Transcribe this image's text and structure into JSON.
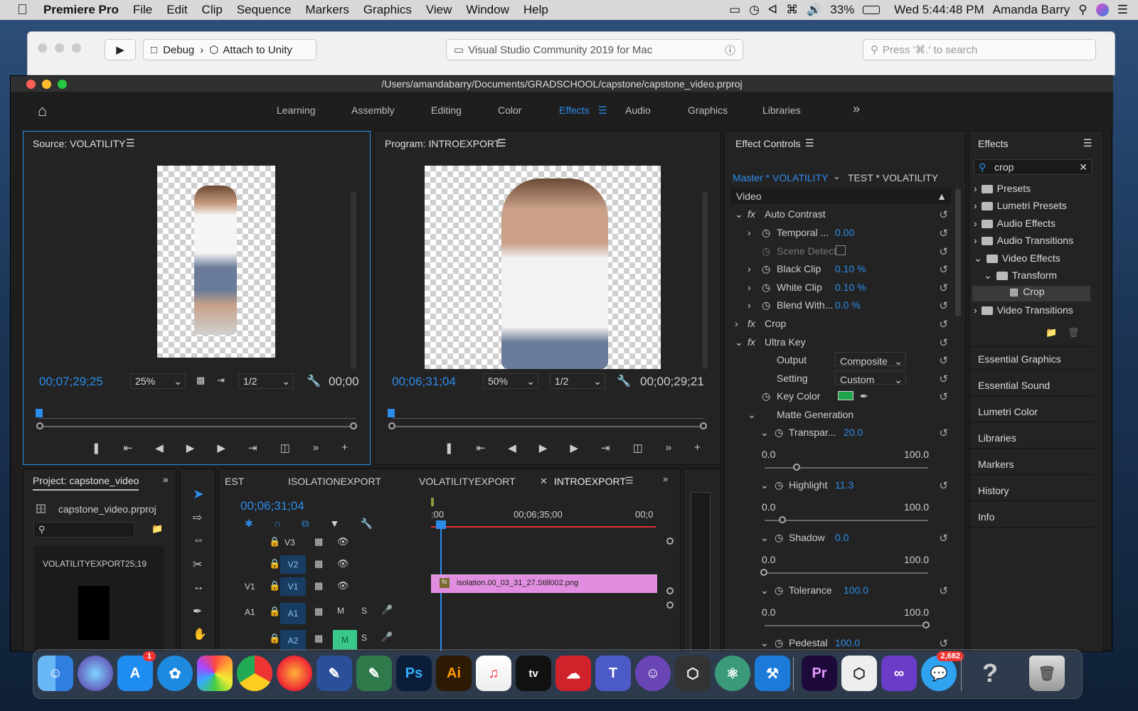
{
  "menubar": {
    "app": "Premiere Pro",
    "items": [
      "File",
      "Edit",
      "Clip",
      "Sequence",
      "Markers",
      "Graphics",
      "View",
      "Window",
      "Help"
    ],
    "battery": "33%",
    "clock": "Wed 5:44:48 PM",
    "user": "Amanda Barry"
  },
  "vs": {
    "config": "Debug",
    "target": "Attach to Unity",
    "title": "Visual Studio Community 2019 for Mac",
    "search_placeholder": "Press '⌘.' to search"
  },
  "premiere": {
    "path": "/Users/amandabarry/Documents/GRADSCHOOL/capstone/capstone_video.prproj",
    "workspaces": [
      "Learning",
      "Assembly",
      "Editing",
      "Color",
      "Effects",
      "Audio",
      "Graphics",
      "Libraries"
    ],
    "active_workspace": "Effects",
    "source": {
      "title": "Source: VOLATILITY",
      "timecode": "00;07;29;25",
      "zoom": "25%",
      "res": "1/2",
      "duration": "00;00"
    },
    "program": {
      "title": "Program: INTROEXPORT",
      "timecode": "00;06;31;04",
      "zoom": "50%",
      "res": "1/2",
      "duration": "00;00;29;21"
    },
    "effect_controls": {
      "title": "Effect Controls",
      "master": "Master * VOLATILITY",
      "clip": "TEST * VOLATILITY",
      "section": "Video",
      "auto_contrast": "Auto Contrast",
      "temporal": "Temporal ...",
      "temporal_val": "0.00",
      "scene_detect": "Scene Detect",
      "black_clip": "Black Clip",
      "black_clip_val": "0.10 %",
      "white_clip": "White Clip",
      "white_clip_val": "0.10 %",
      "blend": "Blend With...",
      "blend_val": "0.0 %",
      "crop": "Crop",
      "ultra_key": "Ultra Key",
      "output": "Output",
      "output_val": "Composite",
      "setting": "Setting",
      "setting_val": "Custom",
      "key_color": "Key Color",
      "key_color_hex": "#1fa44a",
      "matte": "Matte Generation",
      "transparency": "Transpar...",
      "transparency_val": "20.0",
      "highlight": "Highlight",
      "highlight_val": "11.3",
      "shadow": "Shadow",
      "shadow_val": "0.0",
      "tolerance": "Tolerance",
      "tolerance_val": "100.0",
      "pedestal": "Pedestal",
      "pedestal_val": "100.0",
      "range_min": "0.0",
      "range_max": "100.0"
    },
    "effects": {
      "title": "Effects",
      "search": "crop",
      "items": [
        "Presets",
        "Lumetri Presets",
        "Audio Effects",
        "Audio Transitions",
        "Video Effects",
        "Transform",
        "Crop",
        "Video Transitions"
      ],
      "side": [
        "Essential Graphics",
        "Essential Sound",
        "Lumetri Color",
        "Libraries",
        "Markers",
        "History",
        "Info"
      ]
    },
    "project": {
      "title": "Project: capstone_video",
      "file": "capstone_video.prproj",
      "clip": "VOLATILITYEXPORT",
      "clip_dur": "25;19"
    },
    "timeline": {
      "tabs": [
        "EST",
        "ISOLATIONEXPORT",
        "VOLATILITYEXPORT",
        "INTROEXPORT"
      ],
      "timecode": "00;06;31;04",
      "ruler": [
        ":00",
        "00;06;35;00",
        "00;0"
      ],
      "tracks": {
        "v3": "V3",
        "v2": "V2",
        "v1": "V1",
        "a1": "A1",
        "a2": "A2",
        "src_v1": "V1",
        "src_a1": "A1",
        "m": "M",
        "s": "S"
      },
      "clip": "isolation.00_03_31_27.Still002.png"
    }
  },
  "dock": {
    "badge_appstore": "1",
    "badge_messages": "2,682"
  }
}
